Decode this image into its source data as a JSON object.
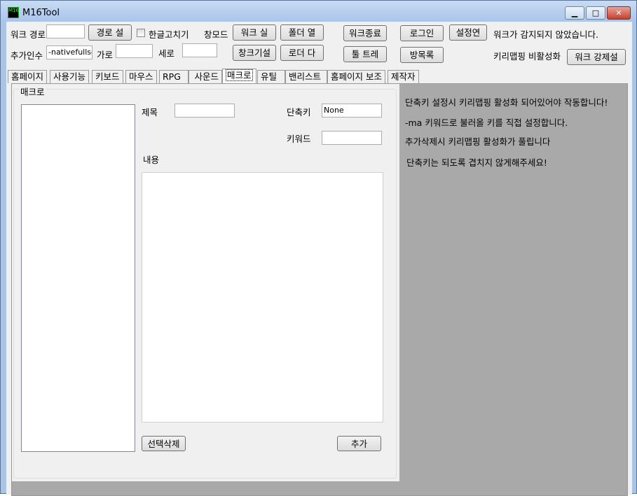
{
  "window": {
    "title": "M16Tool",
    "icon_text": "M16"
  },
  "toolbar": {
    "work_path_label": "워크 경로",
    "work_path_value": "",
    "set_path_button": "경로 설",
    "hangul_fix_label": "한글고치기",
    "hangul_fix_checked": false,
    "window_mode_label": "창모드",
    "run_work_button": "워크 실",
    "open_folder_button": "폴더 열",
    "exit_work_button": "워크종료",
    "login_button": "로그인",
    "settings_button": "설정연",
    "status_text": "워크가 감지되지 않았습니다.",
    "extra_args_label": "추가인수",
    "extra_args_value": "-nativefullscr",
    "width_label": "가로",
    "width_value": "",
    "height_label": "세로",
    "height_value": "",
    "set_window_size_button": "창크기설",
    "loader_button": "로더 다",
    "tool_tray_button": "툴 트레",
    "room_list_button": "방목록",
    "keymapping_status": "키리맵핑 비활성화",
    "force_work_button": "워크 강제설"
  },
  "tabs": [
    "홈페이지",
    "사용기능",
    "키보드",
    "마우스",
    "RPG",
    "사운드",
    "매크로",
    "유틸",
    "밴리스트",
    "홈페이지 보조",
    "제작자"
  ],
  "active_tab": "매크로",
  "macro": {
    "group_label": "매크로",
    "title_label": "제목",
    "title_value": "",
    "hotkey_label": "단축키",
    "hotkey_value": "None",
    "keyword_label": "키워드",
    "keyword_value": "",
    "content_label": "내용",
    "content_value": "",
    "delete_button": "선택삭제",
    "add_button": "추가"
  },
  "notes": [
    "단축키 설정시 키리맵핑 활성화 되어있어야 작동합니다!",
    "-ma 키워드로 불러올 키를 직접 설정합니다.",
    "추가삭제시 키리맵핑 활성화가 풀립니다",
    "단축키는 되도록 겹치지 않게해주세요!"
  ]
}
